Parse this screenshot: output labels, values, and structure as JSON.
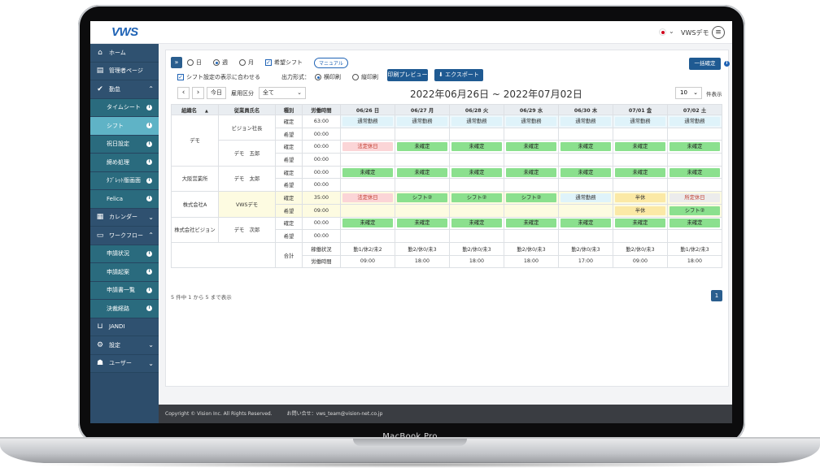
{
  "device_label": "MacBook Pro",
  "header": {
    "logo": "VWS",
    "user": "VWSデモ",
    "menu_icon": "≡"
  },
  "sidebar": {
    "items": [
      {
        "label": "ホーム",
        "icon": "home-icon",
        "glyph": "⌂",
        "type": "main"
      },
      {
        "label": "管理者ページ",
        "icon": "admin-icon",
        "glyph": "▤",
        "type": "main"
      },
      {
        "label": "勤怠",
        "icon": "calendar-check-icon",
        "glyph": "✔",
        "type": "main",
        "chevron": "⌃"
      },
      {
        "label": "タイムシート",
        "type": "sub",
        "info": true
      },
      {
        "label": "シフト",
        "type": "sub",
        "info": true,
        "active": true
      },
      {
        "label": "祝日設定",
        "type": "sub",
        "info": true
      },
      {
        "label": "締め処理",
        "type": "sub",
        "info": true
      },
      {
        "label": "ﾀﾌﾞﾚｯﾄ版画面",
        "type": "sub",
        "info": true
      },
      {
        "label": "Felica",
        "type": "sub",
        "info": true
      },
      {
        "label": "カレンダー",
        "icon": "calendar-icon",
        "glyph": "▦",
        "type": "main",
        "chevron": "⌄"
      },
      {
        "label": "ワークフロー",
        "icon": "workflow-icon",
        "glyph": "▭",
        "type": "main",
        "chevron": "⌃"
      },
      {
        "label": "申請状況",
        "type": "sub",
        "info": true
      },
      {
        "label": "申請起案",
        "type": "sub",
        "info": true
      },
      {
        "label": "申請書一覧",
        "type": "sub",
        "info": true
      },
      {
        "label": "決裁経路",
        "type": "sub",
        "info": true
      },
      {
        "label": "JANDI",
        "icon": "jandi-icon",
        "glyph": "⊔",
        "type": "main"
      },
      {
        "label": "設定",
        "icon": "gear-icon",
        "glyph": "⚙",
        "type": "main",
        "chevron": "⌄"
      },
      {
        "label": "ユーザー",
        "icon": "users-icon",
        "glyph": "☗",
        "type": "main",
        "chevron": "⌄"
      }
    ]
  },
  "toolbar": {
    "period_day": "日",
    "period_week": "週",
    "period_month": "月",
    "wish_shift": "希望シフト",
    "manual": "マニュアル",
    "fit_setting": "シフト設定の表示に合わせる",
    "output_format": "出力形式：",
    "landscape": "横印刷",
    "portrait": "縦印刷",
    "print_preview": "印刷プレビュー",
    "export": "⬇ エクスポート",
    "bulk_confirm": "一括確定",
    "today": "今日",
    "employment_type": "雇用区分",
    "employment_value": "全て",
    "date_range": "2022年06月26日 ~ 2022年07月02日",
    "per_page": "10",
    "per_page_label": "件表示"
  },
  "table": {
    "headers": [
      "組織名",
      "従業員氏名",
      "種別",
      "労働時間",
      "06/26 日",
      "06/27 月",
      "06/28 火",
      "06/29 水",
      "06/30 木",
      "07/01 金",
      "07/02 土"
    ],
    "sort_icon": "▲",
    "rows": [
      {
        "org": "デモ",
        "emp": "ビジョン社長",
        "type": "確定",
        "hours": "63:00",
        "cells": [
          "通常勤務",
          "通常勤務",
          "通常勤務",
          "通常勤務",
          "通常勤務",
          "通常勤務",
          "通常勤務"
        ],
        "kinds": [
          "b",
          "b",
          "b",
          "b",
          "b",
          "b",
          "b"
        ]
      },
      {
        "org": "",
        "emp": "",
        "type": "希望",
        "hours": "00:00",
        "cells": [
          "",
          "",
          "",
          "",
          "",
          "",
          ""
        ],
        "kinds": [
          "",
          "",
          "",
          "",
          "",
          "",
          ""
        ]
      },
      {
        "org": "",
        "emp": "デモ　五郎",
        "type": "確定",
        "hours": "00:00",
        "cells": [
          "法定休日",
          "未確定",
          "未確定",
          "未確定",
          "未確定",
          "未確定",
          "未確定"
        ],
        "kinds": [
          "p",
          "g",
          "g",
          "g",
          "g",
          "g",
          "g"
        ]
      },
      {
        "org": "",
        "emp": "",
        "type": "希望",
        "hours": "00:00",
        "cells": [
          "",
          "",
          "",
          "",
          "",
          "",
          ""
        ],
        "kinds": [
          "",
          "",
          "",
          "",
          "",
          "",
          ""
        ]
      },
      {
        "org": "大阪営業所",
        "emp": "デモ　太郎",
        "type": "確定",
        "hours": "00:00",
        "cells": [
          "未確定",
          "未確定",
          "未確定",
          "未確定",
          "未確定",
          "未確定",
          "未確定"
        ],
        "kinds": [
          "g",
          "g",
          "g",
          "g",
          "g",
          "g",
          "g"
        ]
      },
      {
        "org": "",
        "emp": "",
        "type": "希望",
        "hours": "00:00",
        "cells": [
          "",
          "",
          "",
          "",
          "",
          "",
          ""
        ],
        "kinds": [
          "",
          "",
          "",
          "",
          "",
          "",
          ""
        ]
      },
      {
        "org": "株式会社A",
        "emp": "VWSデモ",
        "type": "確定",
        "hours": "35:00",
        "cells": [
          "法定休日",
          "シフト②",
          "シフト②",
          "シフト②",
          "通常勤務",
          "半休",
          "所定休日"
        ],
        "kinds": [
          "p",
          "g",
          "g",
          "g",
          "b",
          "y",
          "r"
        ]
      },
      {
        "org": "",
        "emp": "",
        "type": "希望",
        "hours": "09:00",
        "cells": [
          "",
          "",
          "",
          "",
          "",
          "半休",
          "シフト②"
        ],
        "kinds": [
          "",
          "",
          "",
          "",
          "",
          "y",
          "g"
        ]
      },
      {
        "org": "株式会社ビジョン",
        "emp": "デモ　次郎",
        "type": "確定",
        "hours": "00:00",
        "cells": [
          "未確定",
          "未確定",
          "未確定",
          "未確定",
          "未確定",
          "未確定",
          "未確定"
        ],
        "kinds": [
          "g",
          "g",
          "g",
          "g",
          "g",
          "g",
          "g"
        ]
      },
      {
        "org": "",
        "emp": "",
        "type": "希望",
        "hours": "00:00",
        "cells": [
          "",
          "",
          "",
          "",
          "",
          "",
          ""
        ],
        "kinds": [
          "",
          "",
          "",
          "",
          "",
          "",
          ""
        ]
      }
    ],
    "summary": {
      "label": "合計",
      "status_label": "稼働状況",
      "hours_label": "労働時間",
      "status": [
        "勤1/休2/未2",
        "勤2/休0/未3",
        "勤2/休0/未3",
        "勤2/休0/未3",
        "勤2/休0/未3",
        "勤2/休0/未3",
        "勤1/休2/未3"
      ],
      "hours": [
        "09:00",
        "18:00",
        "18:00",
        "18:00",
        "17:00",
        "09:00",
        "18:00"
      ]
    }
  },
  "pager": {
    "text": "5 件中 1 から 5 まで表示",
    "page": "1"
  },
  "footer": {
    "copyright": "Copyright © Vision Inc. All Rights Reserved.",
    "contact": "お問い合せ：vws_team@vision-net.co.jp"
  }
}
